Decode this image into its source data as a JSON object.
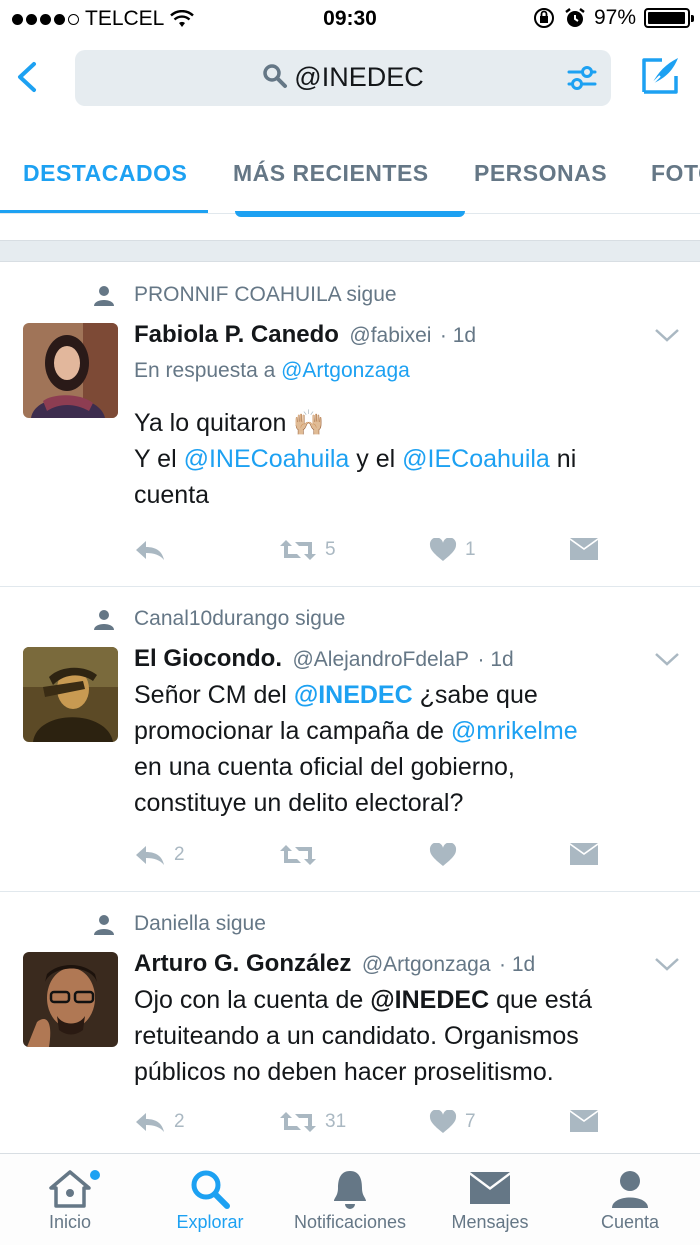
{
  "status_bar": {
    "carrier": "TELCEL",
    "time": "09:30",
    "battery": "97%",
    "battery_level": 0.97
  },
  "search": {
    "query": "@INEDEC"
  },
  "tabs": [
    {
      "label": "DESTACADOS",
      "active": true
    },
    {
      "label": "MÁS RECIENTES",
      "active": false
    },
    {
      "label": "PERSONAS",
      "active": false
    },
    {
      "label": "FOTOS",
      "active": false
    }
  ],
  "tweets": [
    {
      "social_context": "PRONNIF COAHUILA sigue",
      "name": "Fabiola P. Canedo",
      "handle": "@fabixei",
      "age": "· 1d",
      "reply_prefix": "En respuesta a",
      "reply_to": "@Artgonzaga",
      "text": {
        "line1": "Ya lo quitaron 🙌🏼",
        "l2a": "Y el",
        "l2b": "@INECoahuila",
        "l2c": "y el",
        "l2d": "@IECoahuila",
        "l2e": "ni",
        "line3": "cuenta"
      },
      "retweets": "5",
      "likes": "1",
      "replies": ""
    },
    {
      "social_context": "Canal10durango sigue",
      "name": "El Giocondo.",
      "handle": "@AlejandroFdelaP",
      "age": "· 1d",
      "text": {
        "l1a": "Señor CM del",
        "l1b": "@INEDEC",
        "l1c": "¿sabe que",
        "l2a": "promocionar la campaña de",
        "l2b": "@mrikelme",
        "line3": "en una cuenta oficial del gobierno,",
        "line4": "constituye un delito electoral?"
      },
      "replies": "2",
      "retweets": "",
      "likes": ""
    },
    {
      "social_context": "Daniella sigue",
      "name": "Arturo G. González",
      "handle": "@Artgonzaga",
      "age": "· 1d",
      "text": {
        "l1a": "Ojo con la cuenta de",
        "l1b": "@INEDEC",
        "l1c": "que está",
        "line2": "retuiteando a un candidato. Organismos",
        "line3": "públicos no deben hacer proselitismo."
      },
      "replies": "2",
      "retweets": "31",
      "likes": "7"
    }
  ],
  "tabbar": [
    {
      "label": "Inicio",
      "icon": "home-icon"
    },
    {
      "label": "Explorar",
      "icon": "search-icon",
      "active": true
    },
    {
      "label": "Notificaciones",
      "icon": "bell-icon"
    },
    {
      "label": "Mensajes",
      "icon": "envelope-icon"
    },
    {
      "label": "Cuenta",
      "icon": "person-icon"
    }
  ],
  "colors": {
    "accent": "#1da1f2",
    "muted": "#657786",
    "icon_gray": "#aab8c2"
  }
}
